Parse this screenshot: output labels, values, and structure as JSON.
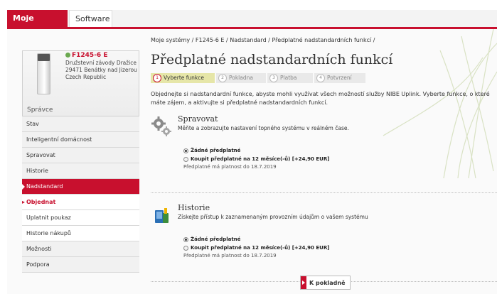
{
  "tabs": [
    {
      "label": "Moje systémy",
      "active": true
    },
    {
      "label": "Software",
      "active": false
    }
  ],
  "device": {
    "status_icon": "check-icon",
    "status_color": "#6aa84f",
    "name": "F1245-6 E",
    "address_lines": [
      "Družstevní závody Dražice",
      "29471 Benátky nad Jizerou",
      "Czech Republic"
    ],
    "role": "Správce"
  },
  "nav": {
    "items": [
      {
        "label": "Stav"
      },
      {
        "label": "Inteligentní domácnost"
      },
      {
        "label": "Spravovat"
      },
      {
        "label": "Historie"
      },
      {
        "label": "Nadstandard"
      },
      {
        "label": "Objednat"
      },
      {
        "label": "Uplatnit poukaz"
      },
      {
        "label": "Historie nákupů"
      },
      {
        "label": "Možnosti"
      },
      {
        "label": "Podpora"
      }
    ]
  },
  "breadcrumb": "Moje systémy / F1245-6 E / Nadstandard / Předplatné nadstandardních funkcí /",
  "title": "Předplatné nadstandardních funkcí",
  "steps": [
    {
      "num": "1",
      "label": "Vyberte funkce"
    },
    {
      "num": "2",
      "label": "Pokladna"
    },
    {
      "num": "3",
      "label": "Platba"
    },
    {
      "num": "4",
      "label": "Potvrzení"
    }
  ],
  "intro": "Objednejte si nadstandardní funkce, abyste mohli využívat všech možností služby NIBE Uplink. Vyberte funkce, o které máte zájem, a aktivujte si předplatné nadstandardních funkcí.",
  "features": [
    {
      "icon": "gears-icon",
      "title": "Spravovat",
      "description": "Měňte a zobrazujte nastavení topného systému v reálném čase.",
      "option_none": "Žádné předplatné",
      "option_buy": "Koupit předplatné na 12 měsíce(-ů) [+24,90 EUR]",
      "validity": "Předplatné má platnost do 18.7.2019"
    },
    {
      "icon": "history-chart-icon",
      "title": "Historie",
      "description": "Získejte přístup k zaznamenaným provozním údajům o vašem systému",
      "option_none": "Žádné předplatné",
      "option_buy": "Koupit předplatné na 12 měsíce(-ů) [+24,90 EUR]",
      "validity": "Předplatné má platnost do 18.7.2019"
    }
  ],
  "checkout_button": "K pokladně",
  "colors": {
    "accent": "#c8102e",
    "step_active": "#e6e6a8"
  }
}
